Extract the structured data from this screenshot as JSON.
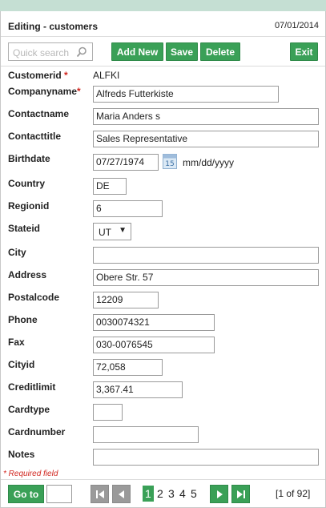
{
  "header": {
    "title": "Editing - customers",
    "date": "07/01/2014"
  },
  "toolbar": {
    "search_placeholder": "Quick search",
    "add_label": "Add New",
    "save_label": "Save",
    "delete_label": "Delete",
    "exit_label": "Exit"
  },
  "form": {
    "customerid": {
      "label": "Customerid",
      "value": "ALFKI"
    },
    "companyname": {
      "label": "Companyname",
      "value": "Alfreds Futterkiste"
    },
    "contactname": {
      "label": "Contactname",
      "value": "Maria Anders s"
    },
    "contacttitle": {
      "label": "Contacttitle",
      "value": "Sales Representative"
    },
    "birthdate": {
      "label": "Birthdate",
      "value": "07/27/1974",
      "format": "mm/dd/yyyy"
    },
    "country": {
      "label": "Country",
      "value": "DE"
    },
    "regionid": {
      "label": "Regionid",
      "value": "6"
    },
    "stateid": {
      "label": "Stateid",
      "value": "UT"
    },
    "city": {
      "label": "City",
      "value": ""
    },
    "address": {
      "label": "Address",
      "value": "Obere Str. 57"
    },
    "postalcode": {
      "label": "Postalcode",
      "value": "12209"
    },
    "phone": {
      "label": "Phone",
      "value": "0030074321"
    },
    "fax": {
      "label": "Fax",
      "value": "030-0076545"
    },
    "cityid": {
      "label": "Cityid",
      "value": "72,058"
    },
    "creditlimit": {
      "label": "Creditlimit",
      "value": "3,367.41"
    },
    "cardtype": {
      "label": "Cardtype",
      "value": ""
    },
    "cardnumber": {
      "label": "Cardnumber",
      "value": ""
    },
    "notes": {
      "label": "Notes",
      "value": ""
    }
  },
  "required_mark": "*",
  "required_note": "* Required field",
  "pager": {
    "goto_label": "Go to",
    "pages": [
      "1",
      "2",
      "3",
      "4",
      "5"
    ],
    "current": "1",
    "info": "[1 of 92]"
  },
  "calendar_day": "15",
  "colors": {
    "accent": "#3aa057",
    "topbar": "#c5dfd3",
    "required": "#d0241d",
    "disabled": "#9a9a9a"
  },
  "icons": {
    "search": "search-icon",
    "calendar": "calendar-icon",
    "first": "first-page-icon",
    "prev": "prev-page-icon",
    "next": "next-page-icon",
    "last": "last-page-icon"
  }
}
